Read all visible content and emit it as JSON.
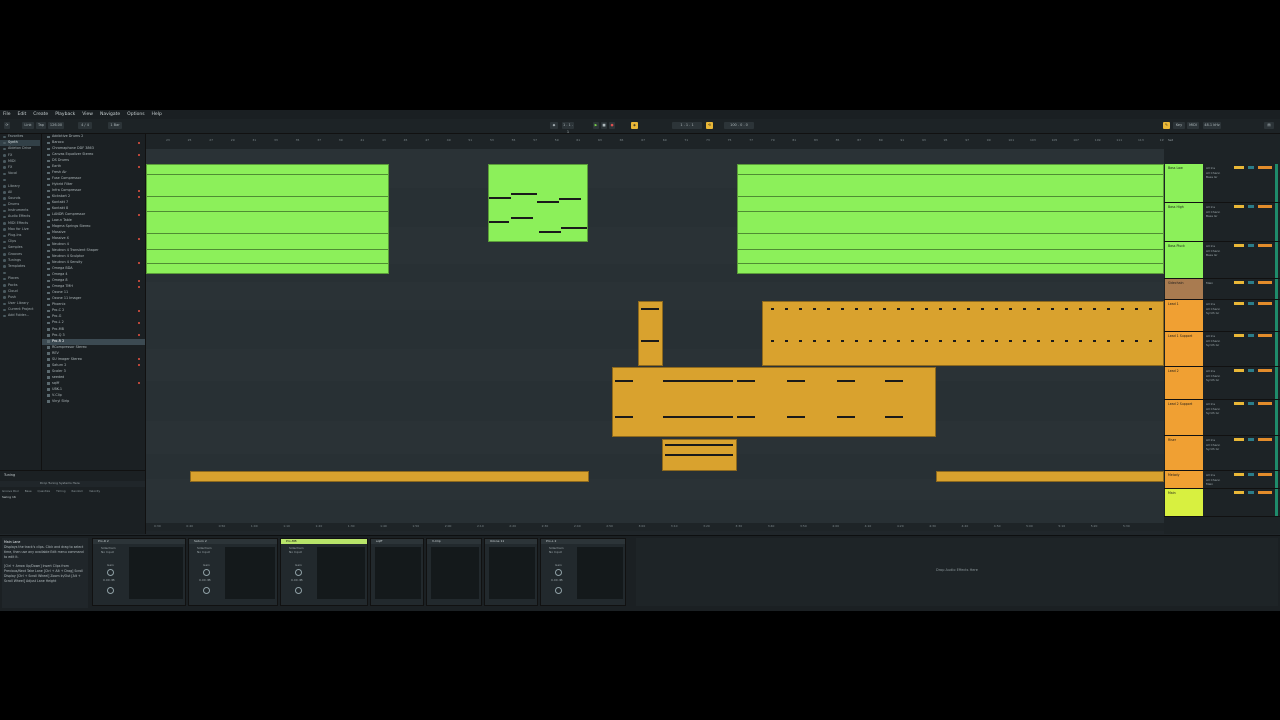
{
  "menu": [
    "File",
    "Edit",
    "Create",
    "Playback",
    "View",
    "Navigate",
    "Options",
    "Help"
  ],
  "transport": {
    "link": "Link",
    "tap": "Tap",
    "tempo": "126.00",
    "signature": "4 / 4",
    "quantize": "1 Bar",
    "position": "1 . 1 . 1",
    "loop_len": "100 . 0 . 0",
    "key": "Key",
    "midi": "MIDI",
    "cpu": "48.1 kHz"
  },
  "browser": {
    "collections_label": "Collections",
    "categories": [
      "Favorites",
      "Synth",
      "Ableton Drive",
      "FX",
      "MIDI",
      "FX",
      "Vocal",
      "",
      "Library",
      "All",
      "Sounds",
      "Drums",
      "Instruments",
      "Audio Effects",
      "MIDI Effects",
      "Max for Live",
      "Plug-Ins",
      "Clips",
      "Samples",
      "Grooves",
      "Tunings",
      "Templates",
      "",
      "Places",
      "Packs",
      "Cloud",
      "Push",
      "User Library",
      "Current Project",
      "Add Folder..."
    ],
    "files": [
      "Addictive Drums 2",
      "Baroco",
      "Chromaphone DDF 3863",
      "Canvas Equalizer Stereo",
      "DS Drums",
      "Earth",
      "Fresh Air",
      "Fuse Compressor",
      "Hybrid Filter",
      "Infra Compressor",
      "Kickstart 2",
      "Kontakt 7",
      "Kontakt 8",
      "LANDR Compressor",
      "Low-n Table",
      "Magma Springs Stereo",
      "Massive",
      "Massive X",
      "Neutron 4",
      "Neutron 4 Transient Shaper",
      "Neutron 4 Sculptor",
      "Neutron 4 Sensity",
      "Omega BDA",
      "Omega 4",
      "Omega 8",
      "Omega TMH",
      "Ozone 11",
      "Ozone 11 Imager",
      "Phoenix",
      "Pro-C 2",
      "Pro-G",
      "Pro-L 2",
      "Pro-MB",
      "Pro-Q 3",
      "Pro-R 2",
      "RCompressor Stereo",
      "REV",
      "SU Imager Stereo",
      "Saturn 2",
      "Scaler 3",
      "seeded",
      "sqiff",
      "UBK-1",
      "V-Clip",
      "Vinyl Strip"
    ],
    "selected_file": "Pro-R 2",
    "status": "1 item selected"
  },
  "groove": {
    "title": "Tuning",
    "cols": [
      "Groove Pool",
      "Base",
      "Quantize",
      "Timing",
      "Random",
      "Velocity"
    ],
    "hint": "Drop Tuning Systems Here",
    "row": "Swing 16"
  },
  "tracks": [
    {
      "name": "Bass Low",
      "color": "#8cf05a",
      "input": "All Ins",
      "sub": "All Chann",
      "out": "Bass Gr"
    },
    {
      "name": "Bass High",
      "color": "#8cf05a",
      "input": "All Ins",
      "sub": "All Chann",
      "out": "Bass Gr"
    },
    {
      "name": "Bass Pluck",
      "color": "#8cf05a",
      "input": "All Ins",
      "sub": "All Chann",
      "out": "Bass Gr"
    },
    {
      "name": "Sidechain",
      "color": "#a97b50",
      "input": "Main",
      "sub": "",
      "out": ""
    },
    {
      "name": "Lead 1",
      "color": "#f0a033",
      "input": "All Ins",
      "sub": "All Chann",
      "out": "Synth Gr"
    },
    {
      "name": "Lead 1 Support",
      "color": "#f0a033",
      "input": "All Ins",
      "sub": "All Chann",
      "out": "Synth Gr"
    },
    {
      "name": "Lead 2",
      "color": "#f0a033",
      "input": "All Ins",
      "sub": "All Chann",
      "out": "Synth Gr"
    },
    {
      "name": "Lead 2 Support",
      "color": "#f0a033",
      "input": "All Ins",
      "sub": "All Chann",
      "out": "Synth Gr"
    },
    {
      "name": "Riser",
      "color": "#f0a033",
      "input": "All Ins",
      "sub": "All Chann",
      "out": "Synth Gr"
    },
    {
      "name": "Melody",
      "color": "#f0a033",
      "input": "All Ins",
      "sub": "All Chann",
      "out": "Main"
    },
    {
      "name": "Main",
      "color": "#d8f040",
      "input": "",
      "sub": "",
      "out": ""
    }
  ],
  "devices": {
    "info_title": "Main Lane",
    "info_text": "Displays the track's clips. Click and drag to select time, then use any available Edit menu command to edit it.",
    "info_keys": "[Ctrl + Arrow Up/Down] Insert Clips from Previous/Next Take Lane [Ctrl + Alt + Drag] Scroll Display [Ctrl + Scroll Wheel] Zoom In/Out [Alt + Scroll Wheel] Adjust Lane Height",
    "chain": [
      {
        "name": "Pro-R 2",
        "label": "Sidechain",
        "sub": "No Input",
        "knob": "Gain",
        "val": "0.00 dB"
      },
      {
        "name": "Saturn 2",
        "label": "Sidechain",
        "sub": "No Input",
        "knob": "Gain",
        "val": "0.00 dB"
      },
      {
        "name": "Pro-MB",
        "label": "Sidechain",
        "sub": "No Input",
        "knob": "Gain",
        "val": "0.00 dB"
      },
      {
        "name": "sqiff",
        "label": "",
        "sub": "",
        "knob": "",
        "val": ""
      },
      {
        "name": "V-Clip",
        "label": "",
        "sub": "",
        "knob": "",
        "val": ""
      },
      {
        "name": "Ozone 11",
        "label": "",
        "sub": "",
        "knob": "",
        "val": ""
      },
      {
        "name": "Pro-L 2",
        "label": "Sidechain",
        "sub": "No Input",
        "knob": "Gain",
        "val": "0.00 dB"
      }
    ],
    "drop_hint": "Drop Audio Effects Here"
  },
  "ruler_labels": [
    "23",
    "25",
    "27",
    "29",
    "31",
    "33",
    "35",
    "37",
    "39",
    "41",
    "43",
    "45",
    "47",
    "49",
    "51",
    "53",
    "55",
    "57",
    "59",
    "61",
    "63",
    "65",
    "67",
    "69",
    "71",
    "73",
    "75",
    "77",
    "79",
    "81",
    "83",
    "85",
    "87",
    "89",
    "91",
    "93",
    "95",
    "97",
    "99",
    "101",
    "103",
    "105",
    "107",
    "109",
    "111",
    "113",
    "115"
  ],
  "time_labels": [
    "0:30",
    "0:40",
    "0:50",
    "1:00",
    "1:10",
    "1:20",
    "1:30",
    "1:40",
    "1:50",
    "2:00",
    "2:10",
    "2:20",
    "2:30",
    "2:40",
    "2:50",
    "3:00",
    "3:10",
    "3:20",
    "3:30",
    "3:40",
    "3:50",
    "4:00",
    "4:10",
    "4:20",
    "4:30",
    "4:40",
    "4:50",
    "5:00",
    "5:10",
    "5:20",
    "5:30"
  ],
  "colors": {
    "green": "#8cf05a",
    "gold": "#d9a22e",
    "main": "#d8f040"
  }
}
